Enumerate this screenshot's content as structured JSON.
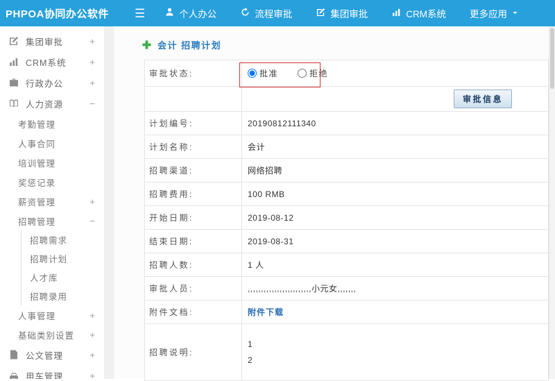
{
  "topbar": {
    "logo": "PHPOA协同办公软件",
    "nav": [
      {
        "label": "个人办公",
        "icon": "person-icon"
      },
      {
        "label": "流程审批",
        "icon": "cycle-icon"
      },
      {
        "label": "集团审批",
        "icon": "edit-square-icon"
      },
      {
        "label": "CRM系统",
        "icon": "bar-chart-icon"
      },
      {
        "label": "更多应用",
        "icon": "caret-down-icon"
      }
    ]
  },
  "sidebar": {
    "items": [
      {
        "label": "集团审批",
        "toggle": "+",
        "icon": "edit-square-icon"
      },
      {
        "label": "CRM系统",
        "toggle": "+",
        "icon": "bar-chart-icon"
      },
      {
        "label": "行政办公",
        "toggle": "+",
        "icon": "briefcase-icon"
      },
      {
        "label": "人力资源",
        "toggle": "−",
        "icon": "book-icon"
      },
      {
        "label": "考勤管理"
      },
      {
        "label": "人事合同"
      },
      {
        "label": "培训管理"
      },
      {
        "label": "奖惩记录"
      },
      {
        "label": "薪资管理",
        "toggle": "+"
      },
      {
        "label": "招聘管理",
        "toggle": "−"
      },
      {
        "label": "招聘需求"
      },
      {
        "label": "招聘计划"
      },
      {
        "label": "人才库"
      },
      {
        "label": "招聘录用"
      },
      {
        "label": "人事管理",
        "toggle": "+"
      },
      {
        "label": "基础类别设置",
        "toggle": "+"
      },
      {
        "label": "公文管理",
        "toggle": "+",
        "icon": "document-icon"
      },
      {
        "label": "用车管理",
        "toggle": "+",
        "icon": "car-icon"
      }
    ]
  },
  "main": {
    "title": "会计 招聘计划",
    "approval": {
      "label": "审批状态:",
      "approve": "批准",
      "reject": "拒绝",
      "approve_checked": true,
      "button": "审批信息"
    },
    "fields": [
      {
        "label": "计划编号:",
        "value": "20190812111340"
      },
      {
        "label": "计划名称:",
        "value": "会计"
      },
      {
        "label": "招聘渠道:",
        "value": "网络招聘"
      },
      {
        "label": "招聘费用:",
        "value": "100 RMB"
      },
      {
        "label": "开始日期:",
        "value": "2019-08-12"
      },
      {
        "label": "结束日期:",
        "value": "2019-08-31"
      },
      {
        "label": "招聘人数:",
        "value": "1 人"
      },
      {
        "label": "审批人员:",
        "value": ",,,,,,,,,,,,,,,,,,,,,,,,小元女,,,,,,,"
      },
      {
        "label": "附件文档:",
        "value": "附件下载"
      },
      {
        "label": "招聘说明:",
        "value": "1\n2"
      }
    ],
    "colors": {
      "topbar_blue": "#27a0dc",
      "title_blue": "#2b7cc0",
      "link_blue": "#2c6fb5",
      "annotation_red": "#cf3430",
      "plus_green": "#3dae49"
    }
  }
}
